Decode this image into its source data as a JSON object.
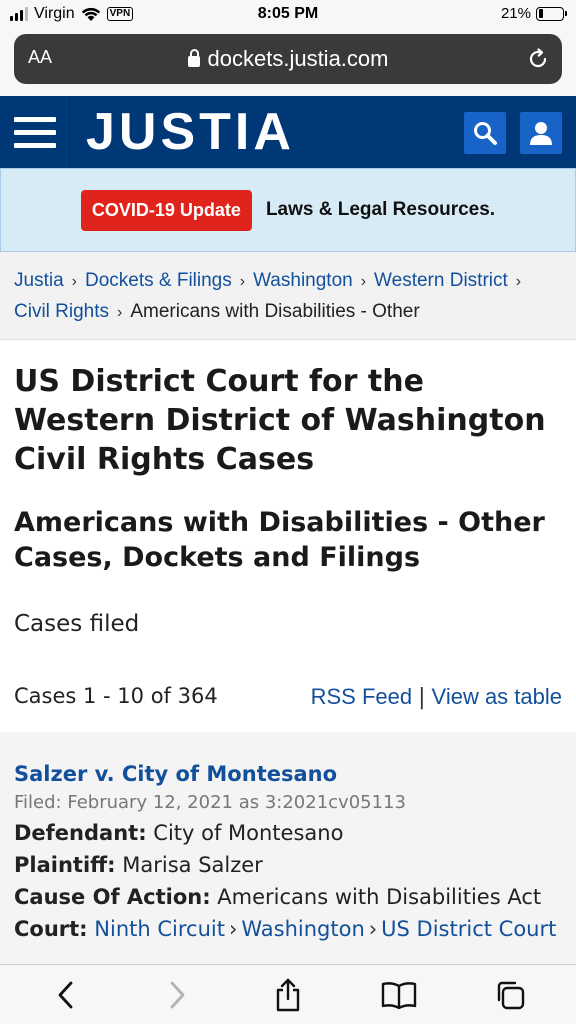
{
  "status_bar": {
    "carrier": "Virgin",
    "vpn": "VPN",
    "time": "8:05 PM",
    "battery": "21%",
    "battery_level": 0.21
  },
  "browser": {
    "text_size_label": "AA",
    "url": "dockets.justia.com"
  },
  "header": {
    "logo": "JUSTIA",
    "colors": {
      "background": "#003777",
      "button": "#1763c7"
    }
  },
  "banner": {
    "button_label": "COVID-19 Update",
    "text": "Laws & Legal Resources."
  },
  "breadcrumb": {
    "items": [
      "Justia",
      "Docket s & Filings",
      "Washington",
      "Western District",
      "Civil Rights"
    ],
    "current": "Americans with Disabilities - Other"
  },
  "page": {
    "title": "US District Court for the Western District of Washington Civil Rights Cases",
    "subtitle": "Americans with Disabilities - Other Cases, Dockets and Filings",
    "section": "Cases filed",
    "count": "Cases 1 - 10 of 364",
    "rss_label": "RSS Feed",
    "separator": "|",
    "table_label": "View as table"
  },
  "case": {
    "title": "Salzer v. City of Montesano",
    "filed": "Filed: February 12, 2021 as 3:2021cv05113",
    "defendant_label": "Defendant:",
    "defendant": "City of Montesano",
    "plaintiff_label": "Plaintiff:",
    "plaintiff": "Marisa Salzer",
    "cause_label": "Cause Of Action:",
    "cause": "Americans with Disabilities Act",
    "court_label": "Court:",
    "court_path": [
      "Ninth Circuit",
      "Washington",
      "US District Court"
    ]
  },
  "toolbar": {
    "icons": [
      "back-icon",
      "forward-icon",
      "share-icon",
      "bookmarks-icon",
      "tabs-icon"
    ]
  }
}
